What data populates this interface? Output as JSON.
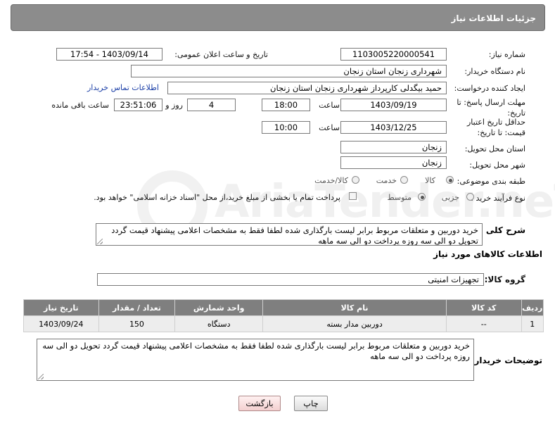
{
  "header": {
    "title": "جزئیات اطلاعات نیاز"
  },
  "fields": {
    "need_number_label": "شماره نیاز:",
    "need_number": "1103005220000541",
    "announce_label": "تاریخ و ساعت اعلان عمومی:",
    "announce_value": "1403/09/14 - 17:54",
    "buyer_org_label": "نام دستگاه خریدار:",
    "buyer_org": "شهرداری زنجان استان زنجان",
    "creator_label": "ایجاد کننده درخواست:",
    "creator": "حمید بیگدلی کارپرداز شهرداری زنجان استان زنجان",
    "contact_link": "اطلاعات تماس خریدار",
    "deadline_label": "مهلت ارسال پاسخ: تا تاریخ:",
    "deadline_date": "1403/09/19",
    "time_label": "ساعت",
    "deadline_time": "18:00",
    "days_value": "4",
    "days_label": "روز و",
    "remaining_time": "23:51:06",
    "remaining_label": "ساعت باقی مانده",
    "validity_label": "حداقل تاریخ اعتبار قیمت: تا تاریخ:",
    "validity_date": "1403/12/25",
    "validity_time": "10:00",
    "province_label": "استان محل تحویل:",
    "province": "زنجان",
    "city_label": "شهر محل تحویل:",
    "city": "زنجان",
    "category_label": "طبقه بندی موضوعی:",
    "category_options": [
      "کالا",
      "خدمت",
      "کالا/خدمت"
    ],
    "process_label": "نوع فرآیند خرید :",
    "process_options": [
      "جزیی",
      "متوسط"
    ],
    "payment_note": "پرداخت تمام یا بخشی از مبلغ خرید،از محل \"اسناد خزانه اسلامی\" خواهد بود.",
    "description_label": "شرح کلی نیاز:",
    "description": "خرید دوربین و متعلقات مربوط برابر لیست بارگذاری شده لطفا فقط به مشخصات اعلامی پیشنهاد قیمت گردد تحویل دو الی سه روزه پرداخت دو الی سه ماهه"
  },
  "goods_section": {
    "title": "اطلاعات کالاهای مورد نیاز",
    "group_label": "گروه کالا:",
    "group_value": "تجهیزات امنیتی"
  },
  "table": {
    "headers": [
      "ردیف",
      "کد کالا",
      "نام کالا",
      "واحد شمارش",
      "تعداد / مقدار",
      "تاریخ نیاز"
    ],
    "rows": [
      [
        "1",
        "--",
        "دوربین مدار بسته",
        "دستگاه",
        "150",
        "1403/09/24"
      ]
    ]
  },
  "buyer_notes": {
    "label": "توضیحات خریدار:",
    "text": "خرید دوربین و متعلقات مربوط برابر لیست بارگذاری شده لطفا فقط به مشخصات اعلامی پیشنهاد قیمت گردد تحویل دو الی سه روزه پرداخت دو الی سه ماهه"
  },
  "buttons": {
    "print": "چاپ",
    "back": "بازگشت"
  },
  "watermark": {
    "text": "AriaTender.neT"
  },
  "colors": {
    "header_bg": "#8c8c8c",
    "table_header_bg": "#7f7f7f",
    "link": "#1a3ea6"
  }
}
